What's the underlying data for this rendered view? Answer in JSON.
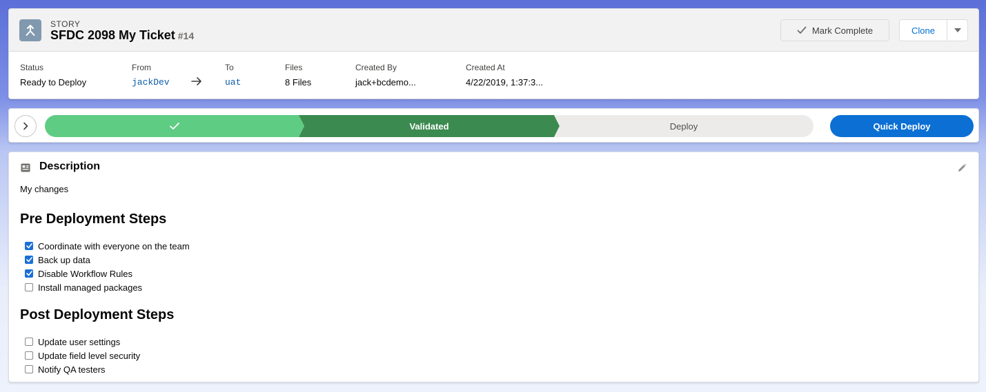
{
  "header": {
    "record_type": "STORY",
    "title": "SFDC 2098 My Ticket",
    "number": "#14",
    "actions": {
      "mark_complete": "Mark Complete",
      "clone": "Clone"
    },
    "fields": {
      "status": {
        "label": "Status",
        "value": "Ready to Deploy"
      },
      "from": {
        "label": "From",
        "value": "jackDev"
      },
      "to": {
        "label": "To",
        "value": "uat"
      },
      "files": {
        "label": "Files",
        "value": "8 Files"
      },
      "created_by": {
        "label": "Created By",
        "value": "jack+bcdemo..."
      },
      "created_at": {
        "label": "Created At",
        "value": "4/22/2019, 1:37:3..."
      }
    }
  },
  "path": {
    "stages": [
      {
        "label": "",
        "state": "complete"
      },
      {
        "label": "Validated",
        "state": "current"
      },
      {
        "label": "Deploy",
        "state": "incomplete"
      }
    ],
    "action": "Quick Deploy"
  },
  "body": {
    "description_title": "Description",
    "description_text": "My changes",
    "pre_title": "Pre Deployment Steps",
    "pre_steps": [
      {
        "label": "Coordinate with everyone on the team",
        "checked": true
      },
      {
        "label": "Back up data",
        "checked": true
      },
      {
        "label": "Disable Workflow Rules",
        "checked": true
      },
      {
        "label": "Install managed packages",
        "checked": false
      }
    ],
    "post_title": "Post Deployment Steps",
    "post_steps": [
      {
        "label": "Update user settings",
        "checked": false
      },
      {
        "label": "Update field level security",
        "checked": false
      },
      {
        "label": "Notify QA testers",
        "checked": false
      }
    ]
  },
  "colors": {
    "brand_blue": "#0b6fd4",
    "path_complete": "#5fcc84",
    "path_current": "#3b8a4f",
    "path_incomplete": "#ecebea",
    "record_icon": "#8199af"
  },
  "icons": {
    "record": "merge-arrows-icon",
    "mark_complete": "check-icon",
    "clone_menu": "caret-down-icon",
    "arrow": "arrow-right-icon",
    "path_toggle": "chevron-right-icon",
    "description": "note-icon",
    "edit": "pencil-icon"
  }
}
